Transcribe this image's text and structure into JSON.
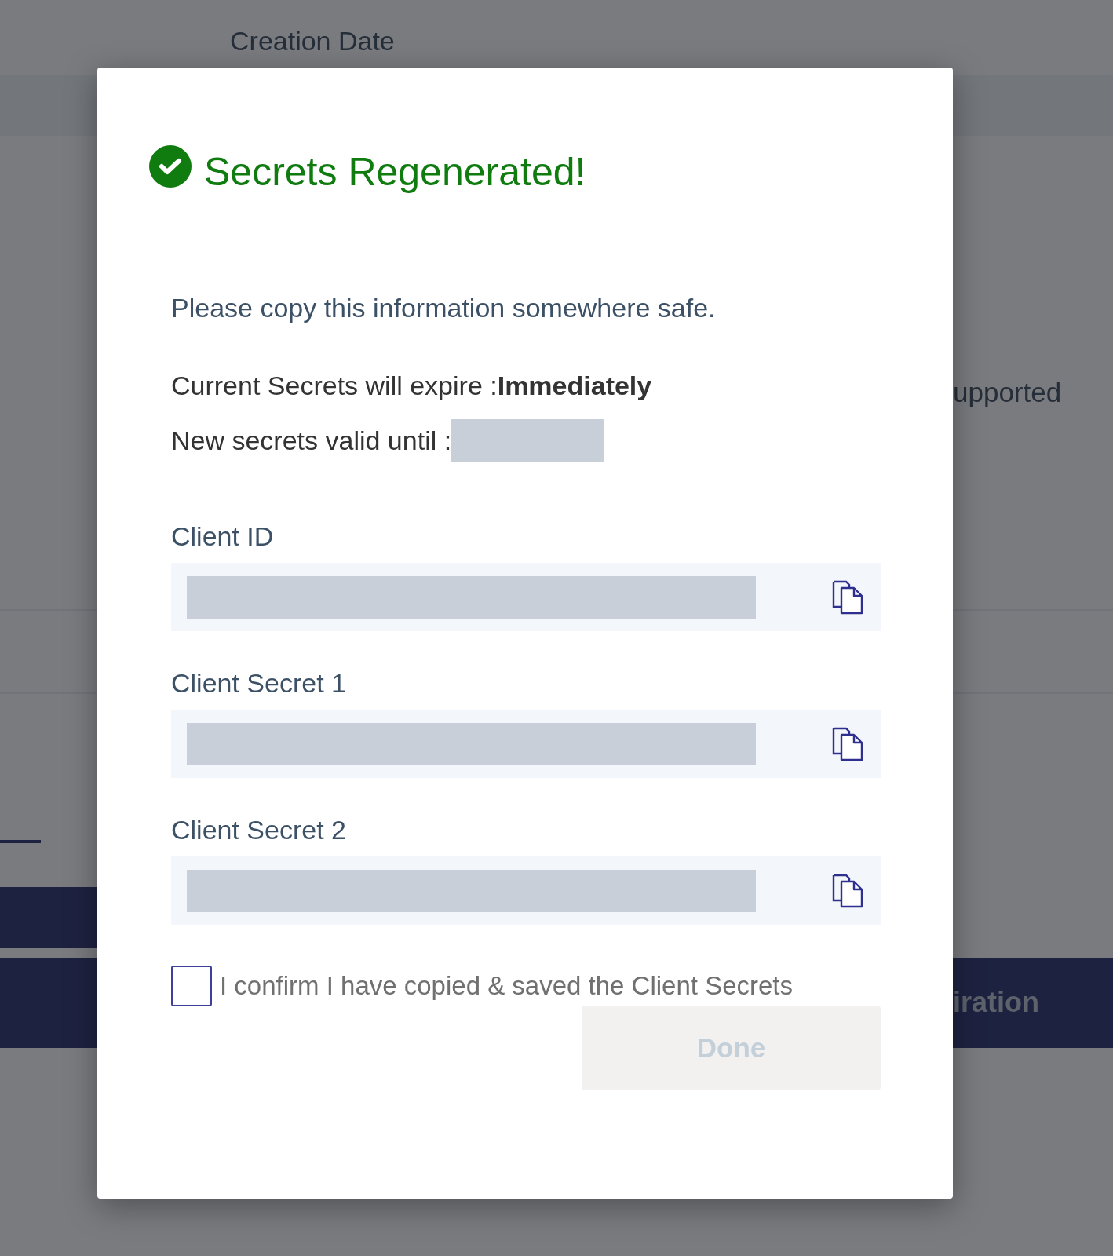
{
  "background": {
    "column_header": "Creation Date",
    "side_text": "upported",
    "band_text": "iration"
  },
  "dialog": {
    "kind": "success",
    "title": "Secrets Regenerated!",
    "message": "Please copy this information somewhere safe.",
    "expiry": "Current Secrets will expire :**Immediately**",
    "valid_until_label": "New secrets valid until :",
    "valid_until_masked": true,
    "fields": [
      {
        "label": "Client ID",
        "masked": true
      },
      {
        "label": "Client Secret 1",
        "masked": true
      },
      {
        "label": "Client Secret 2",
        "masked": true
      }
    ],
    "confirm": {
      "label": "I confirm I have copied & saved the Client Secrets",
      "checked": false
    },
    "done_button": {
      "label": "Done",
      "disabled": true
    }
  }
}
